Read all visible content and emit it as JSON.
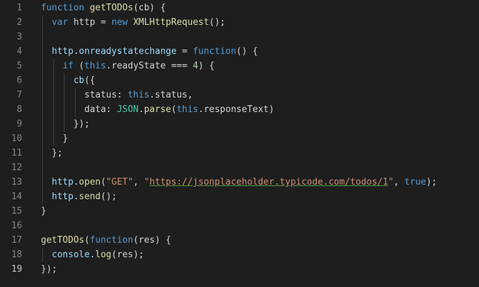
{
  "editor": {
    "active_line": 19,
    "line_numbers": [
      "1",
      "2",
      "3",
      "4",
      "5",
      "6",
      "7",
      "8",
      "9",
      "10",
      "11",
      "12",
      "13",
      "14",
      "15",
      "16",
      "17",
      "18",
      "19"
    ],
    "colors": {
      "background": "#1e1e1e",
      "line_number": "#858585",
      "line_number_active": "#c6c6c6",
      "keyword": "#569cd6",
      "function": "#dcdcaa",
      "variable": "#9cdcfe",
      "string": "#ce9178",
      "number": "#b5cea8",
      "class": "#4ec9b0",
      "url_underline": "#5a9e3a"
    },
    "lines": [
      [
        {
          "t": "function",
          "c": "keyword"
        },
        {
          "t": " "
        },
        {
          "t": "getTODOs",
          "c": "fn"
        },
        {
          "t": "(cb) {"
        }
      ],
      [
        {
          "t": "  "
        },
        {
          "t": "var",
          "c": "keyword"
        },
        {
          "t": " http = "
        },
        {
          "t": "new",
          "c": "keyword"
        },
        {
          "t": " "
        },
        {
          "t": "XMLHttpRequest",
          "c": "fn"
        },
        {
          "t": "();"
        }
      ],
      [],
      [
        {
          "t": "  "
        },
        {
          "t": "http",
          "c": "var"
        },
        {
          "t": "."
        },
        {
          "t": "onreadystatechange",
          "c": "prop"
        },
        {
          "t": " = "
        },
        {
          "t": "function",
          "c": "keyword"
        },
        {
          "t": "() {"
        }
      ],
      [
        {
          "t": "    "
        },
        {
          "t": "if",
          "c": "keyword"
        },
        {
          "t": " ("
        },
        {
          "t": "this",
          "c": "this"
        },
        {
          "t": ".readyState === "
        },
        {
          "t": "4",
          "c": "num"
        },
        {
          "t": ") {"
        }
      ],
      [
        {
          "t": "      "
        },
        {
          "t": "cb",
          "c": "var"
        },
        {
          "t": "({"
        }
      ],
      [
        {
          "t": "        status: "
        },
        {
          "t": "this",
          "c": "this"
        },
        {
          "t": ".status,"
        }
      ],
      [
        {
          "t": "        data: "
        },
        {
          "t": "JSON",
          "c": "class"
        },
        {
          "t": "."
        },
        {
          "t": "parse",
          "c": "fn"
        },
        {
          "t": "("
        },
        {
          "t": "this",
          "c": "this"
        },
        {
          "t": ".responseText)"
        }
      ],
      [
        {
          "t": "      });"
        }
      ],
      [
        {
          "t": "    }"
        }
      ],
      [
        {
          "t": "  };"
        }
      ],
      [],
      [
        {
          "t": "  "
        },
        {
          "t": "http",
          "c": "var"
        },
        {
          "t": "."
        },
        {
          "t": "open",
          "c": "fn"
        },
        {
          "t": "("
        },
        {
          "t": "\"GET\"",
          "c": "string"
        },
        {
          "t": ", "
        },
        {
          "t": "\"",
          "c": "string"
        },
        {
          "t": "https://jsonplaceholder.typicode.com/todos/1",
          "c": "url"
        },
        {
          "t": "\"",
          "c": "string"
        },
        {
          "t": ", "
        },
        {
          "t": "true",
          "c": "keyword"
        },
        {
          "t": ");"
        }
      ],
      [
        {
          "t": "  "
        },
        {
          "t": "http",
          "c": "var"
        },
        {
          "t": "."
        },
        {
          "t": "send",
          "c": "fn"
        },
        {
          "t": "();"
        }
      ],
      [
        {
          "t": "}"
        }
      ],
      [],
      [
        {
          "t": "getTODOs",
          "c": "fn"
        },
        {
          "t": "("
        },
        {
          "t": "function",
          "c": "keyword"
        },
        {
          "t": "(res) {"
        }
      ],
      [
        {
          "t": "  "
        },
        {
          "t": "console",
          "c": "var"
        },
        {
          "t": "."
        },
        {
          "t": "log",
          "c": "fn"
        },
        {
          "t": "(res);"
        }
      ],
      [
        {
          "t": "});"
        }
      ]
    ]
  }
}
